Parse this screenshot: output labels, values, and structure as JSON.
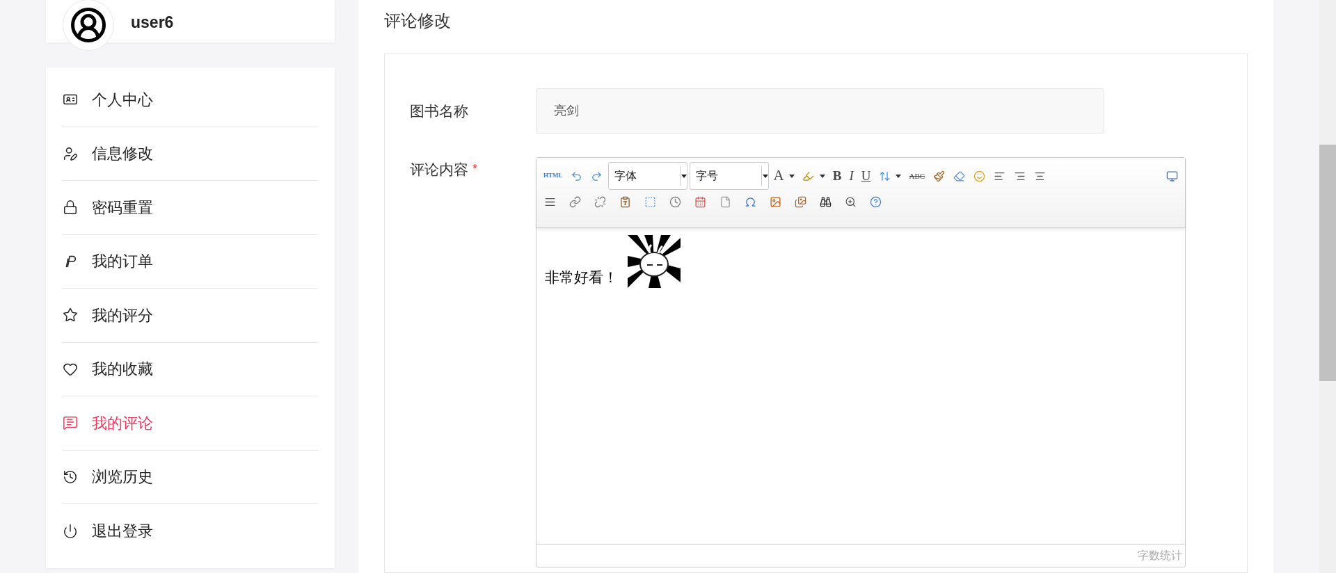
{
  "user_card": {
    "username": "user6"
  },
  "sidebar": {
    "items": [
      {
        "label": "个人中心",
        "kind": "profile",
        "selected": false
      },
      {
        "label": "信息修改",
        "kind": "edit",
        "selected": false
      },
      {
        "label": "密码重置",
        "kind": "password",
        "selected": false
      },
      {
        "label": "我的订单",
        "kind": "orders",
        "selected": false
      },
      {
        "label": "我的评分",
        "kind": "ratings",
        "selected": false
      },
      {
        "label": "我的收藏",
        "kind": "favorites",
        "selected": false
      },
      {
        "label": "我的评论",
        "kind": "comments",
        "selected": true
      },
      {
        "label": "浏览历史",
        "kind": "history",
        "selected": false
      },
      {
        "label": "退出登录",
        "kind": "logout",
        "selected": false
      }
    ]
  },
  "main": {
    "title": "评论修改",
    "form": {
      "book_name": {
        "label": "图书名称",
        "value": "亮剑"
      },
      "comment": {
        "label": "评论内容",
        "required_mark": "*",
        "toolbar": {
          "html": "HTML",
          "font": "字体",
          "size": "字号",
          "font_color": "A",
          "bold": "B",
          "italic": "I",
          "underline": "U",
          "strikethrough": "ABC"
        },
        "content": "非常好看！",
        "word_count": "字数统计"
      }
    }
  }
}
